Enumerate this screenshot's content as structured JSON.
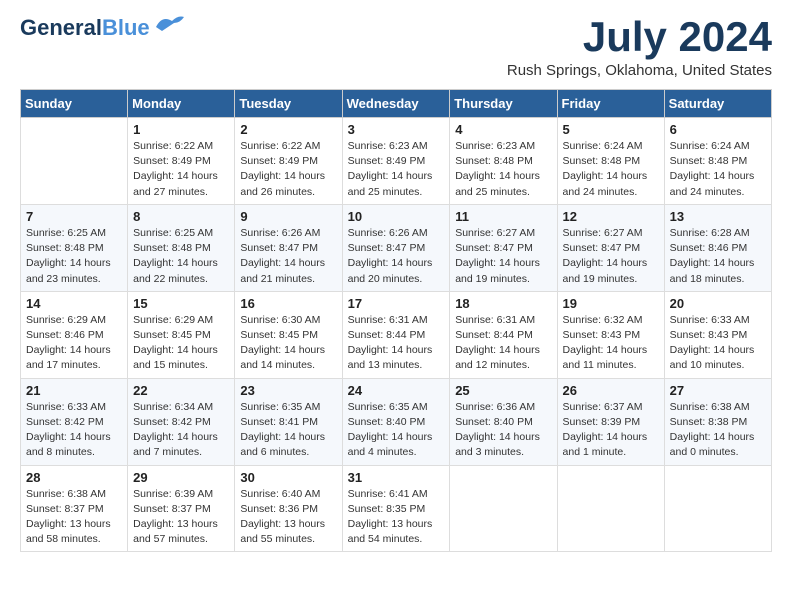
{
  "header": {
    "logo_line1": "General",
    "logo_line2": "Blue",
    "month_year": "July 2024",
    "location": "Rush Springs, Oklahoma, United States"
  },
  "days_of_week": [
    "Sunday",
    "Monday",
    "Tuesday",
    "Wednesday",
    "Thursday",
    "Friday",
    "Saturday"
  ],
  "weeks": [
    [
      {
        "day": "",
        "info": ""
      },
      {
        "day": "1",
        "info": "Sunrise: 6:22 AM\nSunset: 8:49 PM\nDaylight: 14 hours\nand 27 minutes."
      },
      {
        "day": "2",
        "info": "Sunrise: 6:22 AM\nSunset: 8:49 PM\nDaylight: 14 hours\nand 26 minutes."
      },
      {
        "day": "3",
        "info": "Sunrise: 6:23 AM\nSunset: 8:49 PM\nDaylight: 14 hours\nand 25 minutes."
      },
      {
        "day": "4",
        "info": "Sunrise: 6:23 AM\nSunset: 8:48 PM\nDaylight: 14 hours\nand 25 minutes."
      },
      {
        "day": "5",
        "info": "Sunrise: 6:24 AM\nSunset: 8:48 PM\nDaylight: 14 hours\nand 24 minutes."
      },
      {
        "day": "6",
        "info": "Sunrise: 6:24 AM\nSunset: 8:48 PM\nDaylight: 14 hours\nand 24 minutes."
      }
    ],
    [
      {
        "day": "7",
        "info": "Sunrise: 6:25 AM\nSunset: 8:48 PM\nDaylight: 14 hours\nand 23 minutes."
      },
      {
        "day": "8",
        "info": "Sunrise: 6:25 AM\nSunset: 8:48 PM\nDaylight: 14 hours\nand 22 minutes."
      },
      {
        "day": "9",
        "info": "Sunrise: 6:26 AM\nSunset: 8:47 PM\nDaylight: 14 hours\nand 21 minutes."
      },
      {
        "day": "10",
        "info": "Sunrise: 6:26 AM\nSunset: 8:47 PM\nDaylight: 14 hours\nand 20 minutes."
      },
      {
        "day": "11",
        "info": "Sunrise: 6:27 AM\nSunset: 8:47 PM\nDaylight: 14 hours\nand 19 minutes."
      },
      {
        "day": "12",
        "info": "Sunrise: 6:27 AM\nSunset: 8:47 PM\nDaylight: 14 hours\nand 19 minutes."
      },
      {
        "day": "13",
        "info": "Sunrise: 6:28 AM\nSunset: 8:46 PM\nDaylight: 14 hours\nand 18 minutes."
      }
    ],
    [
      {
        "day": "14",
        "info": "Sunrise: 6:29 AM\nSunset: 8:46 PM\nDaylight: 14 hours\nand 17 minutes."
      },
      {
        "day": "15",
        "info": "Sunrise: 6:29 AM\nSunset: 8:45 PM\nDaylight: 14 hours\nand 15 minutes."
      },
      {
        "day": "16",
        "info": "Sunrise: 6:30 AM\nSunset: 8:45 PM\nDaylight: 14 hours\nand 14 minutes."
      },
      {
        "day": "17",
        "info": "Sunrise: 6:31 AM\nSunset: 8:44 PM\nDaylight: 14 hours\nand 13 minutes."
      },
      {
        "day": "18",
        "info": "Sunrise: 6:31 AM\nSunset: 8:44 PM\nDaylight: 14 hours\nand 12 minutes."
      },
      {
        "day": "19",
        "info": "Sunrise: 6:32 AM\nSunset: 8:43 PM\nDaylight: 14 hours\nand 11 minutes."
      },
      {
        "day": "20",
        "info": "Sunrise: 6:33 AM\nSunset: 8:43 PM\nDaylight: 14 hours\nand 10 minutes."
      }
    ],
    [
      {
        "day": "21",
        "info": "Sunrise: 6:33 AM\nSunset: 8:42 PM\nDaylight: 14 hours\nand 8 minutes."
      },
      {
        "day": "22",
        "info": "Sunrise: 6:34 AM\nSunset: 8:42 PM\nDaylight: 14 hours\nand 7 minutes."
      },
      {
        "day": "23",
        "info": "Sunrise: 6:35 AM\nSunset: 8:41 PM\nDaylight: 14 hours\nand 6 minutes."
      },
      {
        "day": "24",
        "info": "Sunrise: 6:35 AM\nSunset: 8:40 PM\nDaylight: 14 hours\nand 4 minutes."
      },
      {
        "day": "25",
        "info": "Sunrise: 6:36 AM\nSunset: 8:40 PM\nDaylight: 14 hours\nand 3 minutes."
      },
      {
        "day": "26",
        "info": "Sunrise: 6:37 AM\nSunset: 8:39 PM\nDaylight: 14 hours\nand 1 minute."
      },
      {
        "day": "27",
        "info": "Sunrise: 6:38 AM\nSunset: 8:38 PM\nDaylight: 14 hours\nand 0 minutes."
      }
    ],
    [
      {
        "day": "28",
        "info": "Sunrise: 6:38 AM\nSunset: 8:37 PM\nDaylight: 13 hours\nand 58 minutes."
      },
      {
        "day": "29",
        "info": "Sunrise: 6:39 AM\nSunset: 8:37 PM\nDaylight: 13 hours\nand 57 minutes."
      },
      {
        "day": "30",
        "info": "Sunrise: 6:40 AM\nSunset: 8:36 PM\nDaylight: 13 hours\nand 55 minutes."
      },
      {
        "day": "31",
        "info": "Sunrise: 6:41 AM\nSunset: 8:35 PM\nDaylight: 13 hours\nand 54 minutes."
      },
      {
        "day": "",
        "info": ""
      },
      {
        "day": "",
        "info": ""
      },
      {
        "day": "",
        "info": ""
      }
    ]
  ]
}
